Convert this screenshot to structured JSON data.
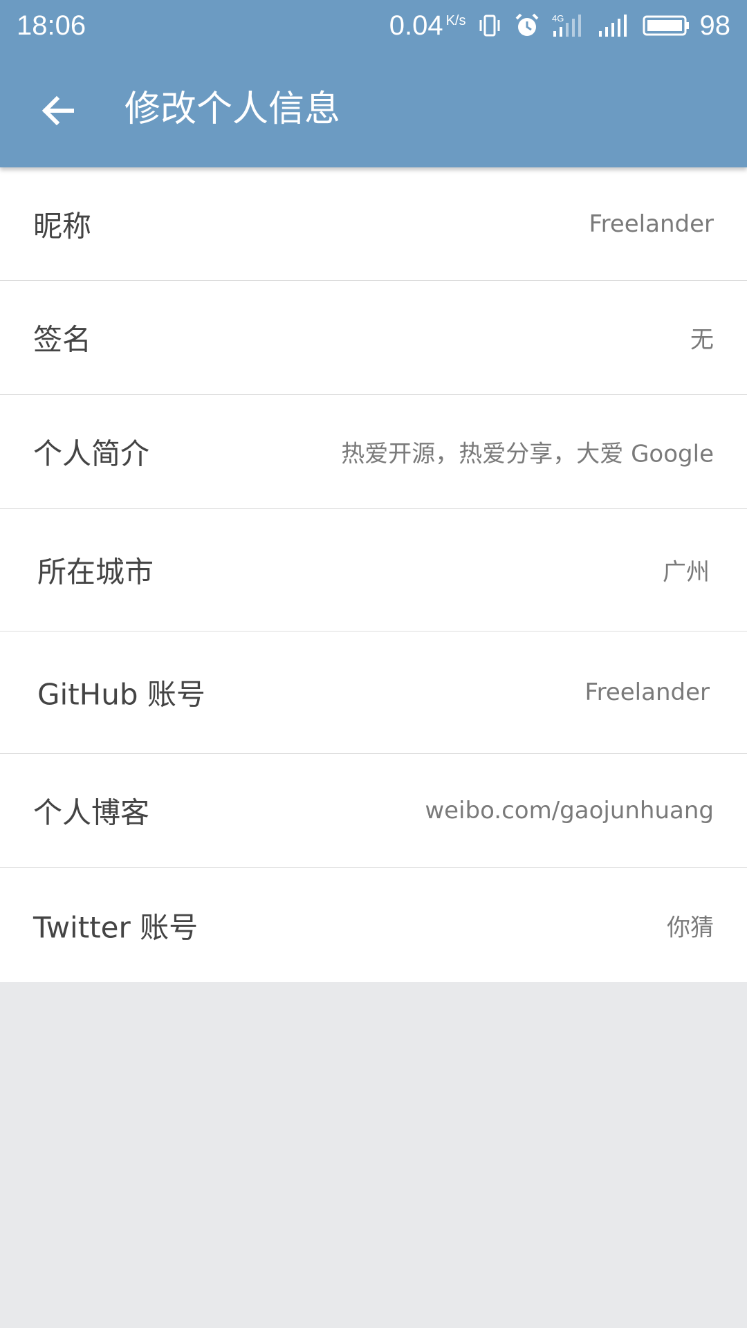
{
  "status_bar": {
    "time": "18:06",
    "net_speed": "0.04",
    "net_unit": "K/s",
    "battery_level": "98",
    "icons": [
      "vibrate-icon",
      "alarm-icon",
      "4g-signal-icon",
      "signal-icon",
      "battery-icon"
    ]
  },
  "header": {
    "title": "修改个人信息",
    "back_icon": "arrow-left-icon",
    "color": "#6c9bc2"
  },
  "rows": [
    {
      "label": "昵称",
      "value": "Freelander"
    },
    {
      "label": "签名",
      "value": "无"
    },
    {
      "label": "个人简介",
      "value": "热爱开源，热爱分享，大爱 Google"
    },
    {
      "label": "所在城市",
      "value": "广州"
    },
    {
      "label": "GitHub 账号",
      "value": "Freelander"
    },
    {
      "label": "个人博客",
      "value": "weibo.com/gaojunhuang"
    },
    {
      "label": "Twitter 账号",
      "value": "你猜"
    }
  ]
}
